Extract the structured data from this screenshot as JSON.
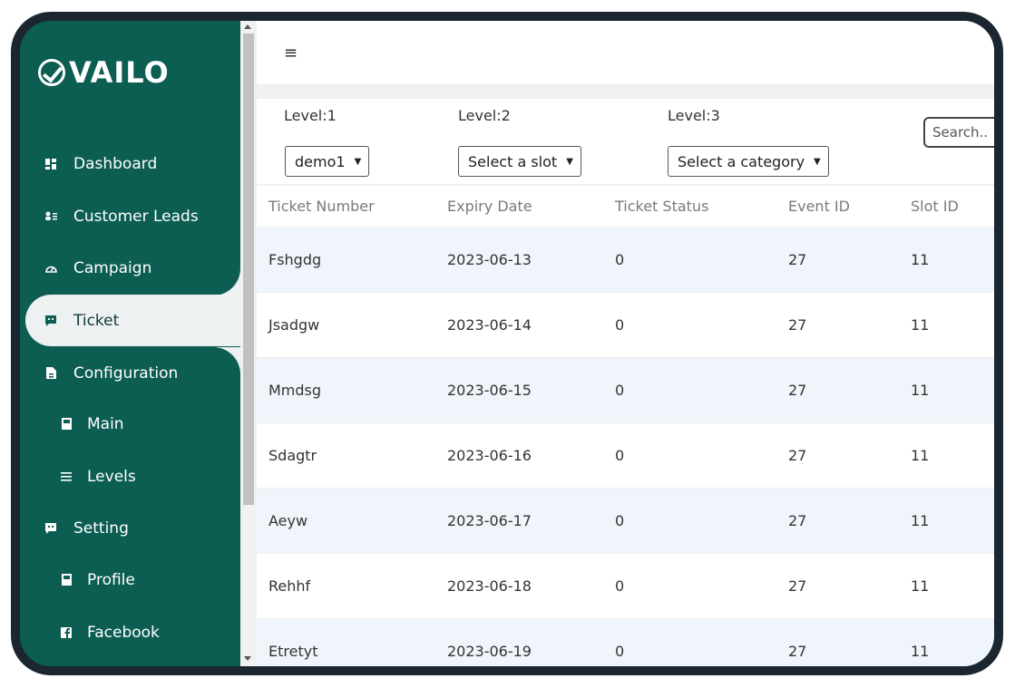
{
  "brand": {
    "name": "VAILO"
  },
  "sidebar": {
    "items": [
      {
        "label": "Dashboard",
        "icon": "dashboard-icon"
      },
      {
        "label": "Customer Leads",
        "icon": "leads-icon"
      },
      {
        "label": "Campaign",
        "icon": "gauge-icon"
      },
      {
        "label": "Ticket",
        "icon": "ticket-icon",
        "active": true
      },
      {
        "label": "Configuration",
        "icon": "file-icon"
      },
      {
        "label": "Main",
        "icon": "book-icon",
        "sub": true
      },
      {
        "label": "Levels",
        "icon": "list-icon",
        "sub": true
      },
      {
        "label": "Setting",
        "icon": "chat-icon"
      },
      {
        "label": "Profile",
        "icon": "book-icon",
        "sub": true
      },
      {
        "label": "Facebook",
        "icon": "facebook-icon",
        "sub": true
      }
    ]
  },
  "topbar": {
    "menu_icon": "hamburger-icon",
    "menu_glyph": "≡"
  },
  "filters": {
    "level1": {
      "label": "Level:1",
      "value": "demo1"
    },
    "level2": {
      "label": "Level:2",
      "value": "Select a slot"
    },
    "level3": {
      "label": "Level:3",
      "value": "Select a category"
    },
    "search_placeholder": "Search.."
  },
  "table": {
    "columns": [
      "Ticket Number",
      "Expiry Date",
      "Ticket Status",
      "Event ID",
      "Slot ID"
    ],
    "rows": [
      [
        "Fshgdg",
        "2023-06-13",
        "0",
        "27",
        "11"
      ],
      [
        "Jsadgw",
        "2023-06-14",
        "0",
        "27",
        "11"
      ],
      [
        "Mmdsg",
        "2023-06-15",
        "0",
        "27",
        "11"
      ],
      [
        "Sdagtr",
        "2023-06-16",
        "0",
        "27",
        "11"
      ],
      [
        "Aeyw",
        "2023-06-17",
        "0",
        "27",
        "11"
      ],
      [
        "Rehhf",
        "2023-06-18",
        "0",
        "27",
        "11"
      ],
      [
        "Etretyt",
        "2023-06-19",
        "0",
        "27",
        "11"
      ]
    ]
  },
  "colors": {
    "sidebar": "#0c5d52",
    "frame": "#1c2630",
    "row_alt": "#eff5fb"
  }
}
